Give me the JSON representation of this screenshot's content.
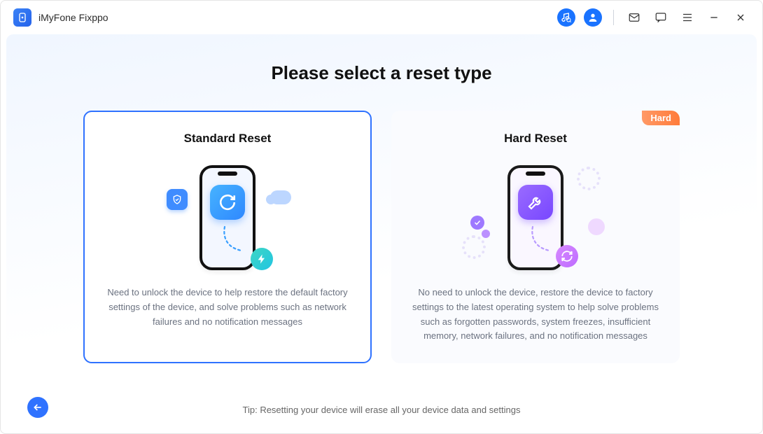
{
  "app": {
    "name": "iMyFone Fixppo"
  },
  "titlebar": {
    "icons": {
      "music": "music-search-icon",
      "user": "user-icon",
      "mail": "mail-icon",
      "feedback": "message-icon",
      "menu": "menu-icon",
      "minimize": "minimize-icon",
      "close": "close-icon"
    }
  },
  "main": {
    "heading": "Please select a reset type",
    "tip": "Tip: Resetting your device will erase all your device data and settings",
    "cards": {
      "standard": {
        "title": "Standard Reset",
        "description": "Need to unlock the device to help restore the default factory settings of the device, and solve problems such as network failures and no notification messages",
        "selected": true
      },
      "hard": {
        "title": "Hard Reset",
        "badge": "Hard",
        "description": "No need to unlock the device, restore the device to factory settings to the latest operating system to help solve problems such as forgotten passwords, system freezes, insufficient memory, network failures, and no notification messages",
        "selected": false
      }
    }
  },
  "nav": {
    "back": "back-button"
  },
  "colors": {
    "primary": "#2f72ff",
    "badge_gradient_start": "#ff9966",
    "badge_gradient_end": "#ff7b3a",
    "card_standard_accent": "#2f88ff",
    "card_hard_accent": "#7847ff"
  }
}
